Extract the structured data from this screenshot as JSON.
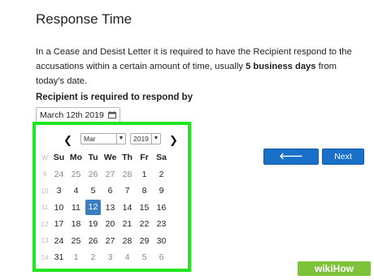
{
  "page": {
    "title": "Response Time",
    "description_before": "In a Cease and Desist Letter it is required to have the Recipient respond to the accusations within a certain amount of time, usually ",
    "description_bold": "5 business days",
    "description_after": " from today's date.",
    "field_label": "Recipient is required to respond by",
    "date_value": "March 12th 2019"
  },
  "calendar": {
    "prev_glyph": "❮",
    "next_glyph": "❯",
    "month_selected": "Mar",
    "year_selected": "2019",
    "week_header": "W",
    "weekday_headers": [
      "Su",
      "Mo",
      "Tu",
      "We",
      "Th",
      "Fr",
      "Sa"
    ],
    "weeks": [
      {
        "wk": "9",
        "days": [
          "24",
          "25",
          "26",
          "27",
          "28",
          "1",
          "2"
        ]
      },
      {
        "wk": "10",
        "days": [
          "3",
          "4",
          "5",
          "6",
          "7",
          "8",
          "9"
        ]
      },
      {
        "wk": "11",
        "days": [
          "10",
          "11",
          "12",
          "13",
          "14",
          "15",
          "16"
        ]
      },
      {
        "wk": "12",
        "days": [
          "17",
          "18",
          "19",
          "20",
          "21",
          "22",
          "23"
        ]
      },
      {
        "wk": "13",
        "days": [
          "24",
          "25",
          "26",
          "27",
          "28",
          "29",
          "30"
        ]
      },
      {
        "wk": "14",
        "days": [
          "31",
          "1",
          "2",
          "3",
          "4",
          "5",
          "6"
        ]
      }
    ],
    "selected_day": "12",
    "highlight_color": "#1fe61f",
    "selected_color": "#3a7fc1"
  },
  "buttons": {
    "previous_label": "Previous",
    "next_label": "Next",
    "previous_icon": "arrow-left-icon",
    "next_icon": "arrow-right-icon",
    "color": "#1a6fc9"
  },
  "watermark": {
    "text": "wikiHow"
  }
}
